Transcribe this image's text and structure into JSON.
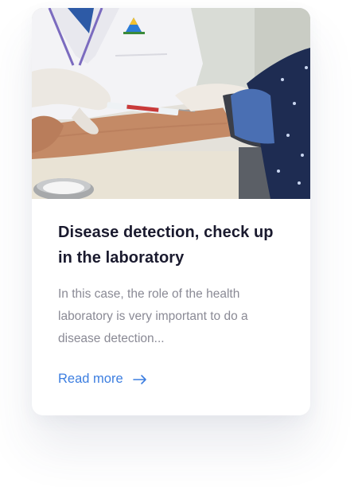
{
  "card": {
    "title": "Disease detection, check up in the laboratory",
    "excerpt": "In this case, the role of the health laboratory is very important to do a disease detection...",
    "read_more_label": "Read more",
    "accent_color": "#3c7ee0",
    "image_alt": "Health worker drawing blood from a patient's arm in a laboratory",
    "arrow_icon": "arrow-right-icon"
  }
}
